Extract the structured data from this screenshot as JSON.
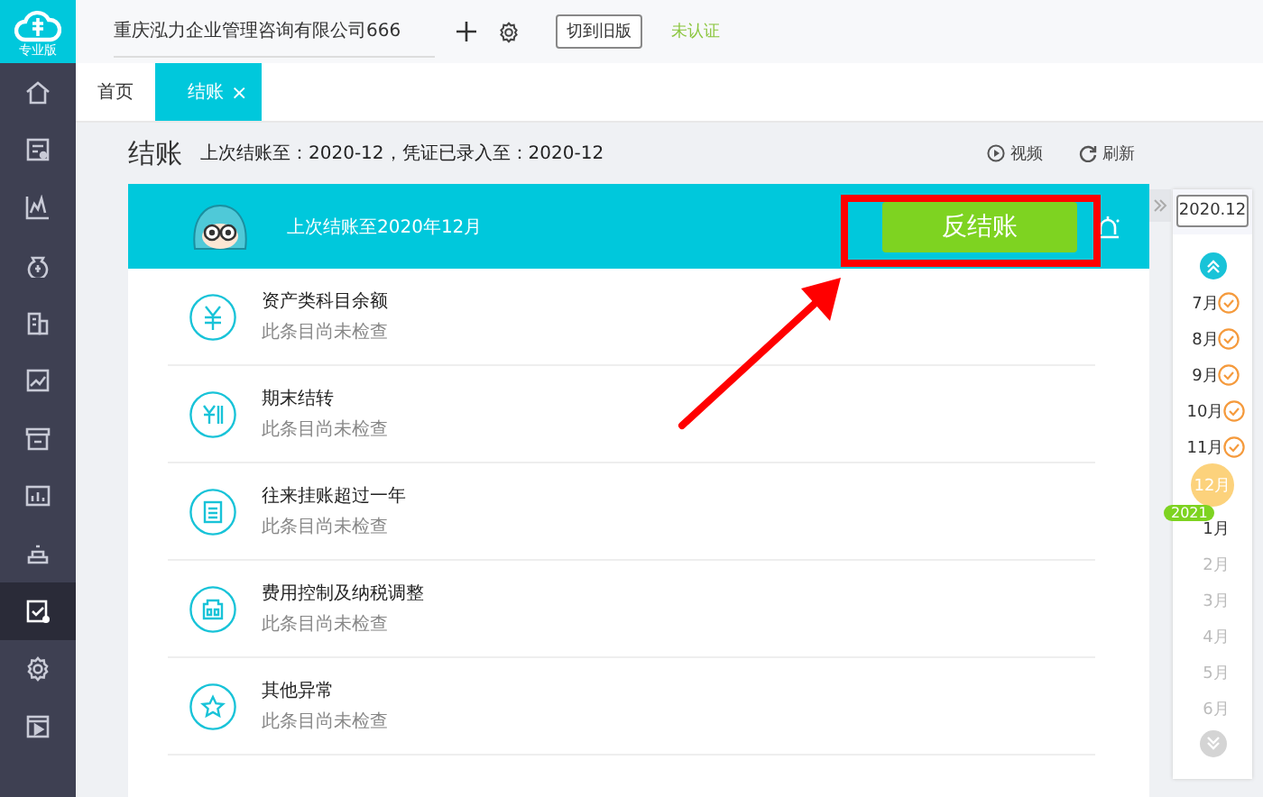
{
  "logo": {
    "label": "专业版"
  },
  "sidebar": {
    "items": [
      {
        "selected": false
      },
      {
        "selected": false
      },
      {
        "selected": false
      },
      {
        "selected": false
      },
      {
        "selected": false
      },
      {
        "selected": false
      },
      {
        "selected": false
      },
      {
        "selected": false
      },
      {
        "selected": false
      },
      {
        "selected": true
      },
      {
        "selected": false
      },
      {
        "selected": false
      }
    ]
  },
  "topbar": {
    "company": "重庆泓力企业管理咨询有限公司666",
    "switch_button": "切到旧版",
    "certification": "未认证"
  },
  "tabs": [
    {
      "label": "首页",
      "selected": false
    },
    {
      "label": "结账",
      "selected": true,
      "close": "×"
    }
  ],
  "page": {
    "title": "结账",
    "summary": "上次结账至：2020-12，凭证已录入至：2020-12",
    "actions": [
      {
        "kind": "video",
        "label": "视频"
      },
      {
        "kind": "refresh",
        "label": "刷新"
      }
    ]
  },
  "banner": {
    "text": "上次结账至2020年12月",
    "button": "反结账"
  },
  "checks": [
    {
      "title": "资产类科目余额",
      "status": "此条目尚未检查"
    },
    {
      "title": "期末结转",
      "status": "此条目尚未检查"
    },
    {
      "title": "往来挂账超过一年",
      "status": "此条目尚未检查"
    },
    {
      "title": "费用控制及纳税调整",
      "status": "此条目尚未检查"
    },
    {
      "title": "其他异常",
      "status": "此条目尚未检查"
    }
  ],
  "period_panel": {
    "current": "2020.12",
    "months": [
      {
        "kind": "month",
        "label": "7月",
        "checked": true,
        "selected": false,
        "disabled": false
      },
      {
        "kind": "month",
        "label": "8月",
        "checked": true,
        "selected": false,
        "disabled": false
      },
      {
        "kind": "month",
        "label": "9月",
        "checked": true,
        "selected": false,
        "disabled": false
      },
      {
        "kind": "month",
        "label": "10月",
        "checked": true,
        "selected": false,
        "disabled": false
      },
      {
        "kind": "month",
        "label": "11月",
        "checked": true,
        "selected": false,
        "disabled": false
      },
      {
        "kind": "month",
        "label": "12月",
        "checked": false,
        "selected": true,
        "disabled": false
      },
      {
        "kind": "year",
        "label": "2021"
      },
      {
        "kind": "month",
        "label": "1月",
        "checked": false,
        "selected": false,
        "disabled": false
      },
      {
        "kind": "month",
        "label": "2月",
        "checked": false,
        "selected": false,
        "disabled": true
      },
      {
        "kind": "month",
        "label": "3月",
        "checked": false,
        "selected": false,
        "disabled": true
      },
      {
        "kind": "month",
        "label": "4月",
        "checked": false,
        "selected": false,
        "disabled": true
      },
      {
        "kind": "month",
        "label": "5月",
        "checked": false,
        "selected": false,
        "disabled": true
      },
      {
        "kind": "month",
        "label": "6月",
        "checked": false,
        "selected": false,
        "disabled": true
      }
    ]
  }
}
